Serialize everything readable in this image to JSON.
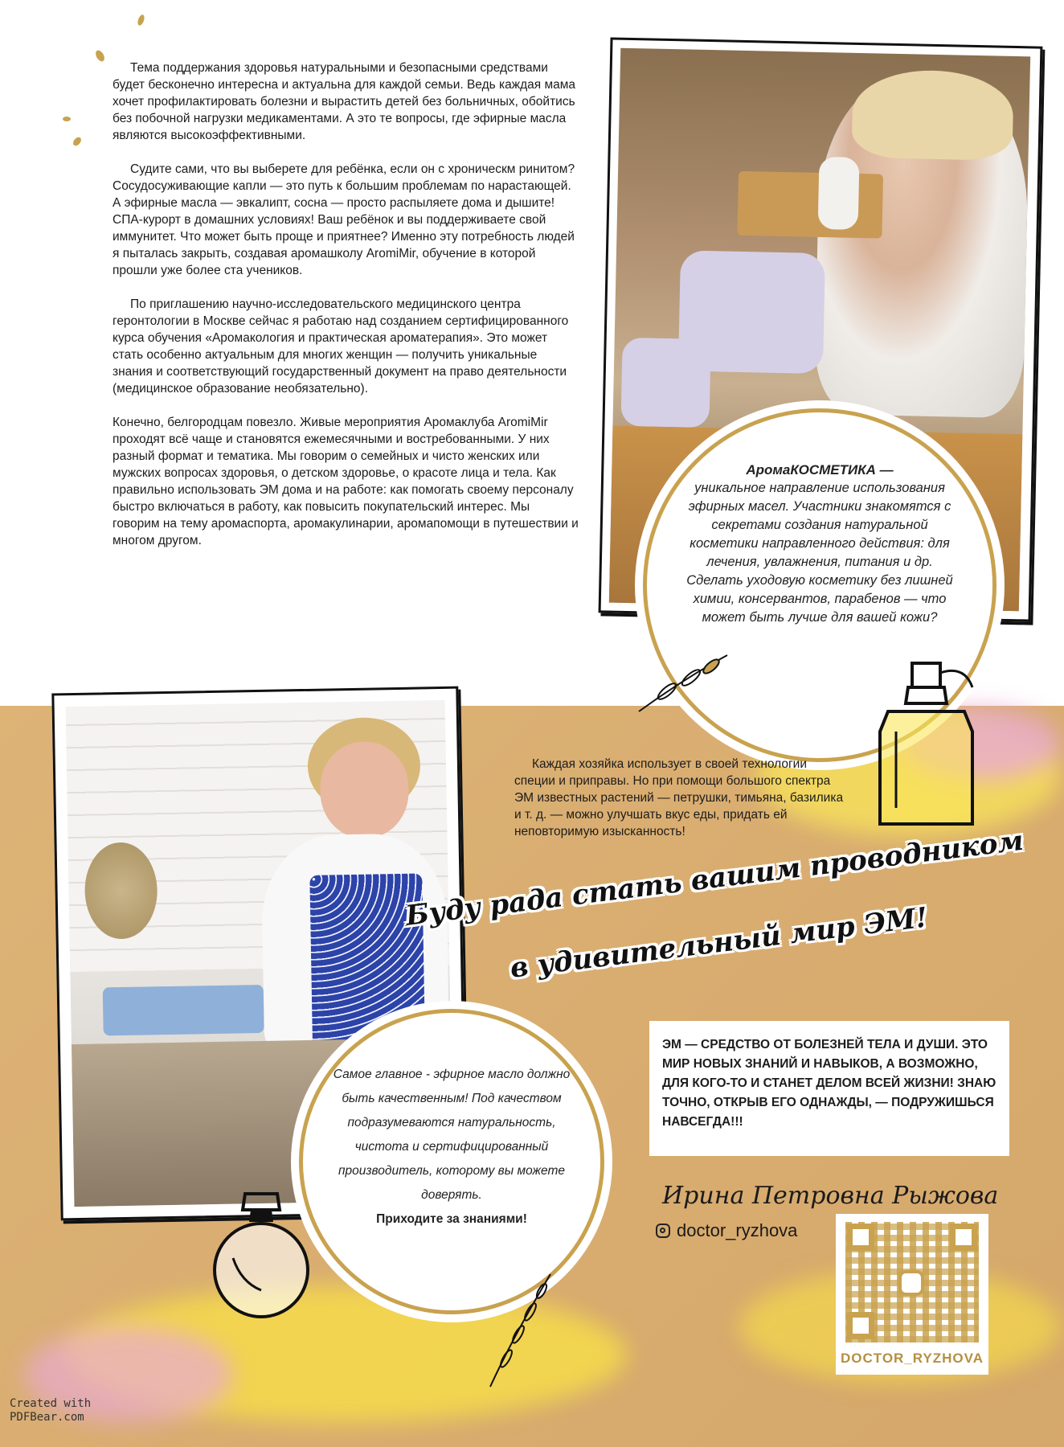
{
  "article": {
    "paragraphs": [
      "Тема поддержания здоровья натуральными и безопасными средствами будет бесконечно интересна и актуальна для каждой семьи. Ведь каждая мама хочет профилактировать болезни и вырастить детей без больничных, обойтись без побочной нагрузки медикаментами. А это те вопросы, где эфирные масла являются высокоэффективными.",
      "Судите сами, что вы выберете для ребёнка, если он с хроническм ринитом? Сосудосуживающие капли — это путь к большим проблемам по нарастающей. А эфирные масла — эвкалипт, сосна — просто распыляете дома и дышите! СПА-курорт в домашних условиях! Ваш ребёнок и вы поддерживаете свой иммунитет. Что может быть проще и приятнее? Именно эту потребность людей я пыталась закрыть, создавая аромашколу AromiMir, обучение в которой прошли уже более ста учеников.",
      "По приглашению научно-исследовательского медицинского центра геронтологии в Москве сейчас я работаю над созданием сертифицированного курса обучения «Аромакология и практическая ароматерапия». Это может стать особенно актуальным для многих женщин — получить уникальные знания и соответствующий государственный документ на право деятельности (медицинское образование необязательно).",
      "Конечно, белгородцам повезло. Живые мероприятия Аромаклуба AromiMir проходят всё чаще и становятся ежемесячными и востребованными. У них разный формат и тематика. Мы говорим о семейных и чисто женских или мужских вопросах здоровья, о детском здоровье, о красоте лица и тела. Как правильно использовать ЭМ дома и на работе: как помогать своему персоналу быстро включаться в работу, как повысить покупательский интерес. Мы говорим на тему аромаспорта, аромакулинарии, аромапомощи в путешествии и многом другом."
    ]
  },
  "circle_cosmetics": {
    "title": "АромаКОСМЕТИКА —",
    "body": "уникальное направление использования эфирных масел. Участники знакомятся с секретами создания натуральной косметики направленного действия: для лечения, увлажнения, питания и др. Сделать уходовую косметику без лишней химии, консервантов, парабенов — что может быть лучше для вашей кожи?"
  },
  "spices_text": "Каждая хозяйка использует в своей технологии специи и приправы. Но при помощи большого спектра ЭМ известных растений — петрушки, тимьяна, базилика и т. д. — можно улучшать вкус еды, придать ей неповторимую изысканность!",
  "headline": {
    "line1": "Буду рада стать вашим проводником",
    "line2": "в удивительный мир ЭМ!"
  },
  "callout": "ЭМ — СРЕДСТВО ОТ БОЛЕЗНЕЙ ТЕЛА И ДУШИ. ЭТО МИР НОВЫХ ЗНАНИЙ И НАВЫКОВ, А ВОЗМОЖНО, ДЛЯ КОГО-ТО И СТАНЕТ ДЕЛОМ ВСЕЙ ЖИЗНИ! ЗНАЮ ТОЧНО, ОТКРЫВ ЕГО ОДНАЖДЫ, — ПОДРУЖИШЬСЯ НАВСЕГДА!!!",
  "circle_quality": {
    "body": "Самое главное - эфирное масло должно быть качественным! Под качеством подразумеваются натуральность, чистота и сертифицированный производитель, которому вы можете доверять.",
    "cta": "Приходите за знаниями!"
  },
  "author": {
    "name": "Ирина Петровна Рыжова",
    "instagram": "doctor_ryzhova",
    "qr_caption": "DOCTOR_RYZHOVA"
  },
  "watermark": {
    "line1": "Created with",
    "line2": "PDFBear.com"
  },
  "colors": {
    "gold": "#c9a24f",
    "kraft": "#d9ad70"
  }
}
